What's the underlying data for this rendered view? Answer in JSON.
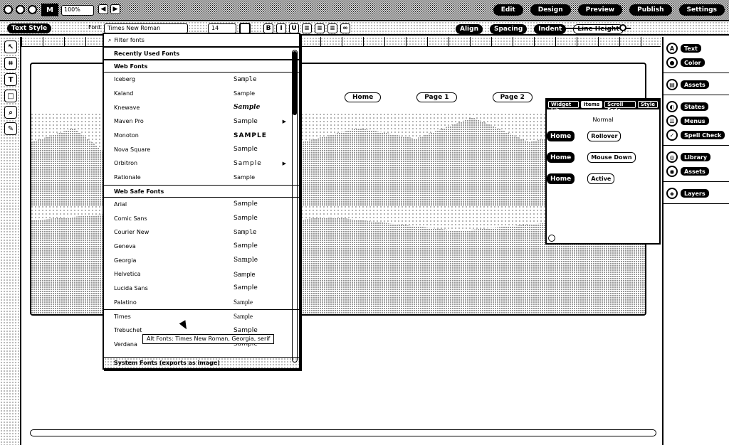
{
  "window": {
    "zoom": "100%",
    "top_buttons": [
      "Edit",
      "Design",
      "Preview",
      "Publish",
      "Settings"
    ]
  },
  "toolbar": {
    "font_button": "Text Style",
    "font_label": "Font",
    "font_value": "Times New Roman",
    "size_value": "14",
    "right_labels": [
      "Align",
      "Spacing",
      "Indent",
      "Line Height"
    ]
  },
  "font_menu": {
    "search_placeholder": "Filter fonts",
    "sections": {
      "recent": "Recently Used Fonts",
      "web": "Web Fonts",
      "web_safe": "Web Safe Fonts",
      "system": "System Fonts (exports as image)"
    },
    "web_fonts": [
      {
        "name": "Iceberg",
        "sample": "Sample"
      },
      {
        "name": "Kaland",
        "sample": "Sample"
      },
      {
        "name": "Knewave",
        "sample": "Sample"
      },
      {
        "name": "Maven Pro",
        "sample": "Sample"
      },
      {
        "name": "Monoton",
        "sample": "SAMPLE"
      },
      {
        "name": "Nova Square",
        "sample": "Sample"
      },
      {
        "name": "Orbitron",
        "sample": "Sample"
      },
      {
        "name": "Rationale",
        "sample": "Sample"
      }
    ],
    "web_safe_fonts": [
      {
        "name": "Arial",
        "sample": "Sample"
      },
      {
        "name": "Comic Sans",
        "sample": "Sample"
      },
      {
        "name": "Courier New",
        "sample": "Sample"
      },
      {
        "name": "Geneva",
        "sample": "Sample"
      },
      {
        "name": "Georgia",
        "sample": "Sample"
      },
      {
        "name": "Helvetica",
        "sample": "Sample"
      },
      {
        "name": "Lucida Sans",
        "sample": "Sample"
      },
      {
        "name": "Palatino",
        "sample": "Sample"
      },
      {
        "name": "Times",
        "sample": "Sample"
      },
      {
        "name": "Trebuchet",
        "sample": "Sample"
      },
      {
        "name": "Verdana",
        "sample": "Sample"
      }
    ],
    "tooltip": "Alt Fonts: Times New Roman, Georgia, serif"
  },
  "site_nav": [
    "Home",
    "Page 1",
    "Page 2"
  ],
  "widget_panel": {
    "tabs": [
      "Widget Lib",
      "Items",
      "Scroll Fade",
      "Style"
    ],
    "state_label": "Normal",
    "rows": [
      {
        "button": "Home",
        "label": "Rollover"
      },
      {
        "button": "Home",
        "label": "Mouse Down"
      },
      {
        "button": "Home",
        "label": "Active"
      }
    ]
  },
  "right_panel": {
    "groups": [
      [
        "Text",
        "Color"
      ],
      [
        "Assets"
      ],
      [
        "States",
        "Menus",
        "Spell Check"
      ],
      [
        "Library",
        "Assets"
      ],
      [
        "Layers"
      ]
    ]
  }
}
